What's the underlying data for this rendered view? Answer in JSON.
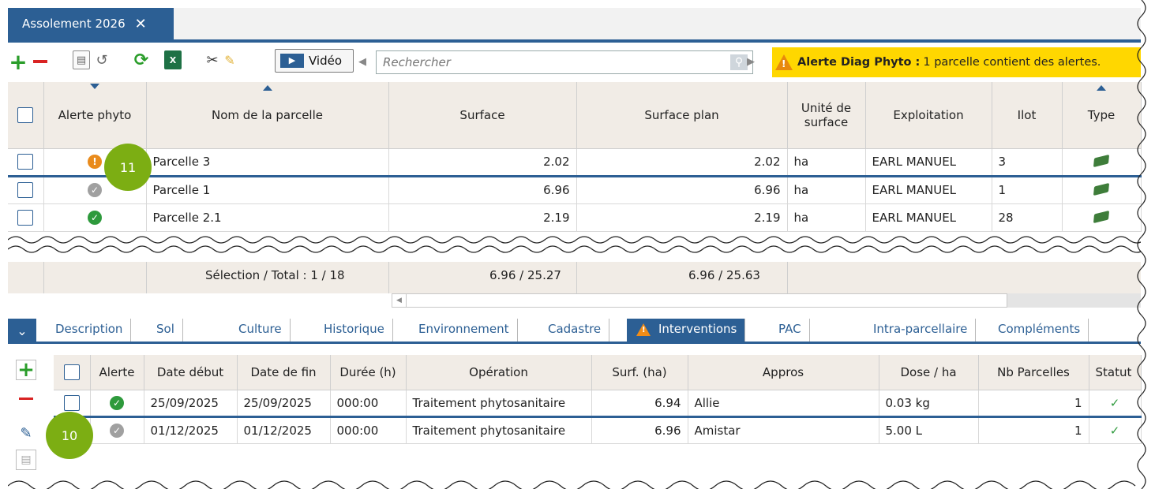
{
  "tab": {
    "title": "Assolement 2026",
    "close": "✕"
  },
  "toolbar": {
    "video_label": "Vidéo",
    "search_placeholder": "Rechercher",
    "alert_title": "Alerte Diag Phyto :",
    "alert_text": "1 parcelle contient des alertes.",
    "excel_label": "X"
  },
  "grid": {
    "headers": {
      "alerte": "Alerte phyto",
      "nom": "Nom de la parcelle",
      "surface": "Surface",
      "surface_plan": "Surface plan",
      "unite": "Unité de surface",
      "exploitation": "Exploitation",
      "ilot": "Ilot",
      "type": "Type"
    },
    "rows": [
      {
        "status": "warning",
        "nom": "Parcelle 3",
        "surface": "2.02",
        "surface_plan": "2.02",
        "unite": "ha",
        "exploitation": "EARL MANUEL",
        "ilot": "3"
      },
      {
        "status": "neutral",
        "nom": "Parcelle 1",
        "surface": "6.96",
        "surface_plan": "6.96",
        "unite": "ha",
        "exploitation": "EARL MANUEL",
        "ilot": "1"
      },
      {
        "status": "ok",
        "nom": "Parcelle 2.1",
        "surface": "2.19",
        "surface_plan": "2.19",
        "unite": "ha",
        "exploitation": "EARL MANUEL",
        "ilot": "28"
      }
    ],
    "totals": {
      "label": "Sélection / Total : 1 / 18",
      "surface": "6.96 / 25.27",
      "surface_plan": "6.96 / 25.63"
    }
  },
  "subtabs": {
    "items": [
      "Description",
      "Sol",
      "Culture",
      "Historique",
      "Environnement",
      "Cadastre",
      "Interventions",
      "PAC",
      "Intra-parcellaire",
      "Compléments"
    ],
    "active": "Interventions"
  },
  "interventions": {
    "headers": {
      "alerte": "Alerte",
      "debut": "Date début",
      "fin": "Date de fin",
      "duree": "Durée (h)",
      "operation": "Opération",
      "surf": "Surf. (ha)",
      "appros": "Appros",
      "dose": "Dose / ha",
      "nb": "Nb Parcelles",
      "statut": "Statut"
    },
    "rows": [
      {
        "status": "ok",
        "debut": "25/09/2025",
        "fin": "25/09/2025",
        "duree": "000:00",
        "operation": "Traitement phytosanitaire",
        "surf": "6.94",
        "appros": "Allie",
        "dose": "0.03 kg",
        "nb": "1",
        "statut": "✓"
      },
      {
        "status": "neutral",
        "debut": "01/12/2025",
        "fin": "01/12/2025",
        "duree": "000:00",
        "operation": "Traitement phytosanitaire",
        "surf": "6.96",
        "appros": "Amistar",
        "dose": "5.00 L",
        "nb": "1",
        "statut": "✓"
      }
    ]
  },
  "badges": {
    "b11": "11",
    "b10": "10"
  },
  "colors": {
    "brand": "#2c5f94",
    "alert": "#ffd700",
    "ok": "#2e9a3c",
    "warning": "#e98b1c",
    "badge": "#7cae13"
  }
}
